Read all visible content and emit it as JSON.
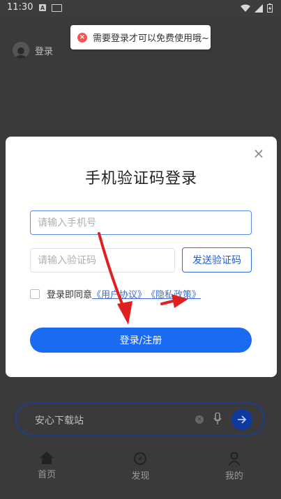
{
  "status_bar": {
    "time": "11:30",
    "notif_letter": "A"
  },
  "background": {
    "login_label": "登录",
    "search": {
      "text": "安心下载站"
    },
    "nav": [
      {
        "label": "首页",
        "icon": "home-icon"
      },
      {
        "label": "发现",
        "icon": "compass-icon"
      },
      {
        "label": "我的",
        "icon": "person-icon"
      }
    ]
  },
  "toast": {
    "text": "需要登录才可以免费使用哦~",
    "icon": "error-icon",
    "color": "#f25656"
  },
  "modal": {
    "title": "手机验证码登录",
    "phone_placeholder": "请输入手机号",
    "code_placeholder": "请输入验证码",
    "send_code_label": "发送验证码",
    "agree_prefix": "登录即同意",
    "user_agreement": "《用户协议》",
    "privacy_policy": "《隐私政策》",
    "submit_label": "登录/注册",
    "accent": "#1a6bf2"
  }
}
